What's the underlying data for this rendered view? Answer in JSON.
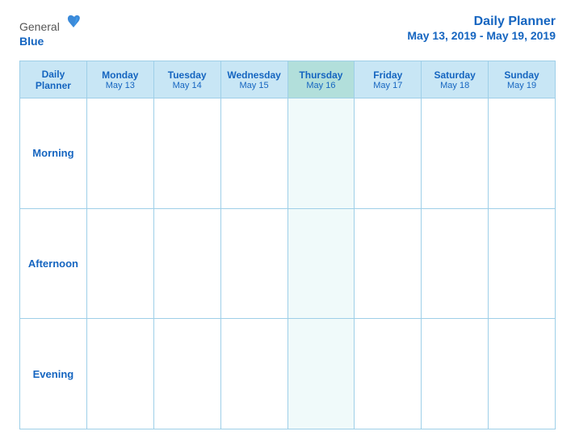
{
  "header": {
    "logo": {
      "general": "General",
      "blue": "Blue"
    },
    "title": "Daily Planner",
    "dateRange": "May 13, 2019 - May 19, 2019"
  },
  "table": {
    "rowHeaderLabel": "Daily Planner",
    "columns": [
      {
        "day": "Monday",
        "date": "May 13",
        "highlighted": false
      },
      {
        "day": "Tuesday",
        "date": "May 14",
        "highlighted": false
      },
      {
        "day": "Wednesday",
        "date": "May 15",
        "highlighted": false
      },
      {
        "day": "Thursday",
        "date": "May 16",
        "highlighted": true
      },
      {
        "day": "Friday",
        "date": "May 17",
        "highlighted": false
      },
      {
        "day": "Saturday",
        "date": "May 18",
        "highlighted": false
      },
      {
        "day": "Sunday",
        "date": "May 19",
        "highlighted": false
      }
    ],
    "rows": [
      {
        "label": "Morning"
      },
      {
        "label": "Afternoon"
      },
      {
        "label": "Evening"
      }
    ]
  }
}
